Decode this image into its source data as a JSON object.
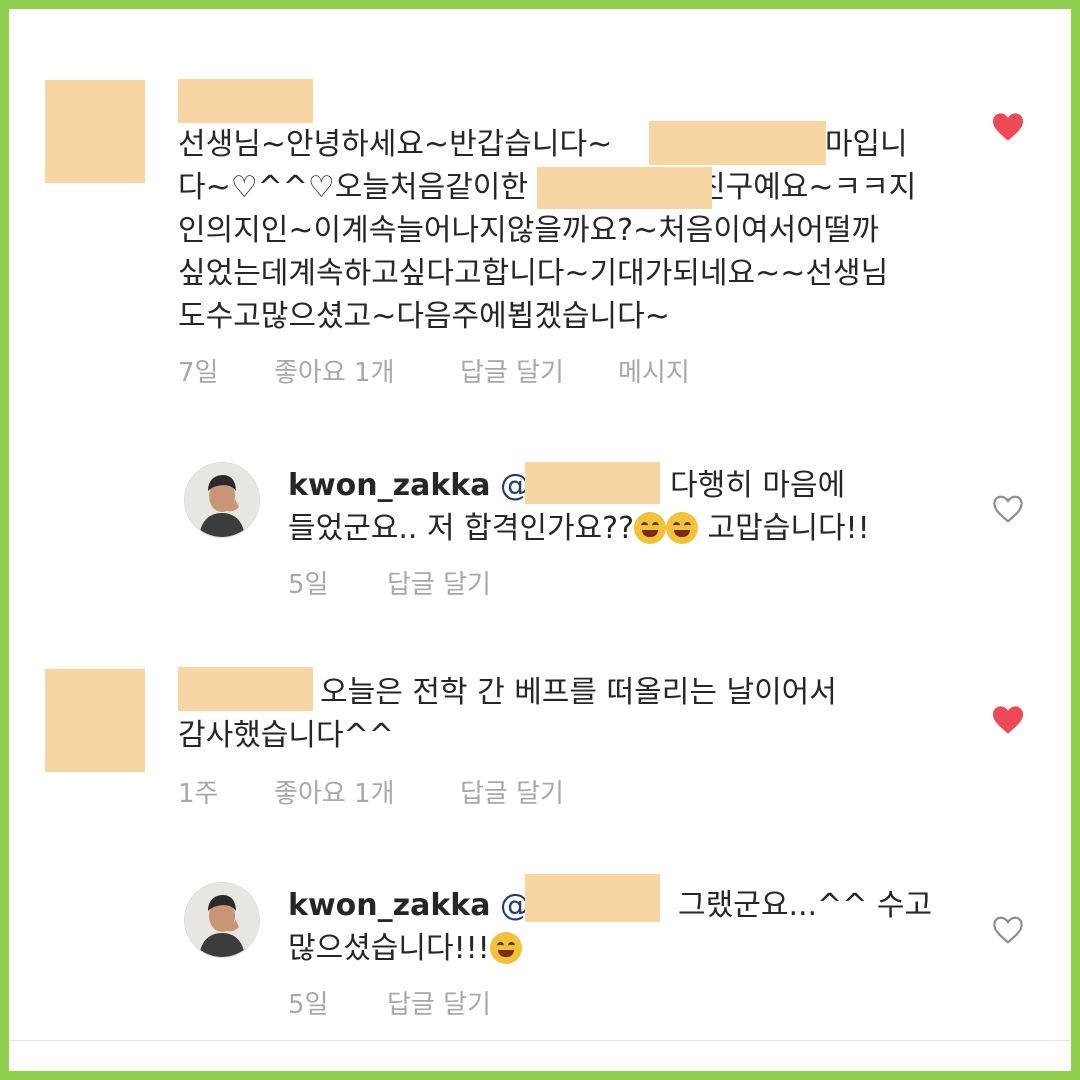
{
  "comments": [
    {
      "lines": [
        [
          "선생님~안녕하세요~반갑습니다~",
          "엄마입니"
        ],
        [
          "다~♡^^♡오늘처음같이한",
          "친구예요~ㅋㅋ지"
        ],
        [
          "인의지인~이계속늘어나지않을까요?~처음이여서어떨까"
        ],
        [
          "싶었는데계속하고싶다고합니다~기대가되네요~~선생님"
        ],
        [
          "도수고많으셨고~다음주에뵙겠습니다~"
        ]
      ],
      "time": "7일",
      "likes": "좋아요 1개",
      "reply": "답글 달기",
      "message": "메시지",
      "liked": true
    },
    {
      "username": "kwon_zakka",
      "mention": "@",
      "line1": "다행히 마음에",
      "line2": "들었군요.. 저 합격인가요??",
      "line2_end": "고맙습니다!!",
      "time": "5일",
      "reply": "답글 달기",
      "liked": false
    },
    {
      "line1": "오늘은 전학 간  베프를  떠올리는 날이어서",
      "line2": "감사했습니다^^",
      "time": "1주",
      "likes": "좋아요 1개",
      "reply": "답글 달기",
      "liked": true
    },
    {
      "username": "kwon_zakka",
      "mention": "@",
      "line1": "그랬군요...^^ 수고",
      "line2": "많으셨습니다!!!",
      "time": "5일",
      "reply": "답글 달기",
      "liked": false
    }
  ],
  "colors": {
    "frame": "#8fd14f",
    "redaction": "#f8d6a3",
    "heart_red": "#ed4956",
    "meta_gray": "#a8a8a8",
    "text": "#262626"
  },
  "icons": {
    "liked": "heart-filled-icon",
    "not_liked": "heart-outline-icon",
    "emoji": "tears-of-joy-emoji"
  }
}
